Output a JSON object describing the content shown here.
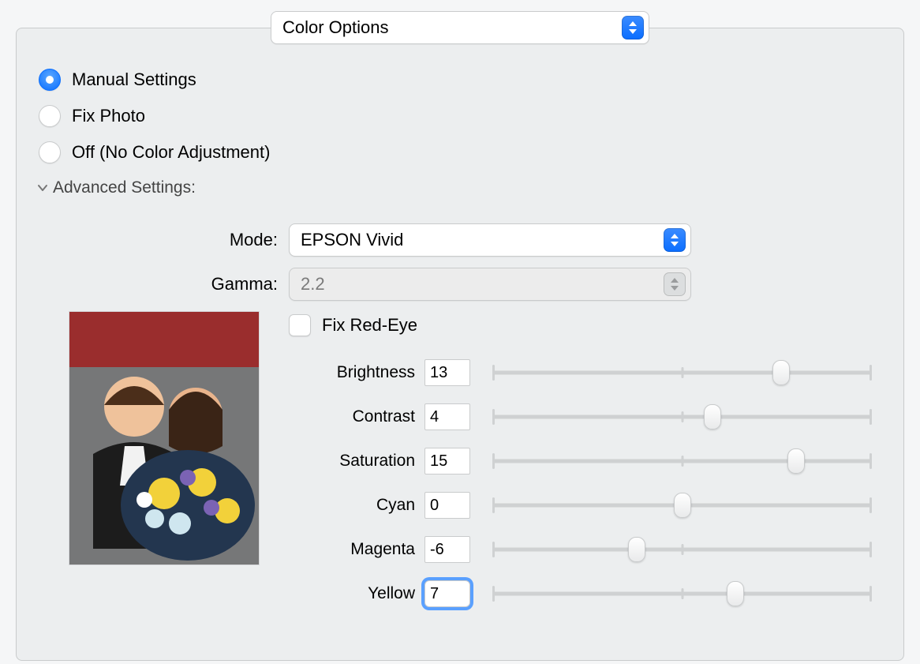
{
  "topDropdown": {
    "selected": "Color Options"
  },
  "radios": {
    "manual": "Manual Settings",
    "fix": "Fix Photo",
    "off": "Off (No Color Adjustment)",
    "selected": "manual"
  },
  "advanced": {
    "label": "Advanced Settings:",
    "mode": {
      "label": "Mode:",
      "value": "EPSON Vivid"
    },
    "gamma": {
      "label": "Gamma:",
      "value": "2.2"
    },
    "fixRedEye": {
      "label": "Fix Red-Eye",
      "checked": false
    }
  },
  "sliders": {
    "min": -25,
    "max": 25,
    "items": [
      {
        "key": "brightness",
        "label": "Brightness",
        "value": 13
      },
      {
        "key": "contrast",
        "label": "Contrast",
        "value": 4
      },
      {
        "key": "saturation",
        "label": "Saturation",
        "value": 15
      },
      {
        "key": "cyan",
        "label": "Cyan",
        "value": 0
      },
      {
        "key": "magenta",
        "label": "Magenta",
        "value": -6
      },
      {
        "key": "yellow",
        "label": "Yellow",
        "value": 7,
        "focused": true
      }
    ]
  }
}
